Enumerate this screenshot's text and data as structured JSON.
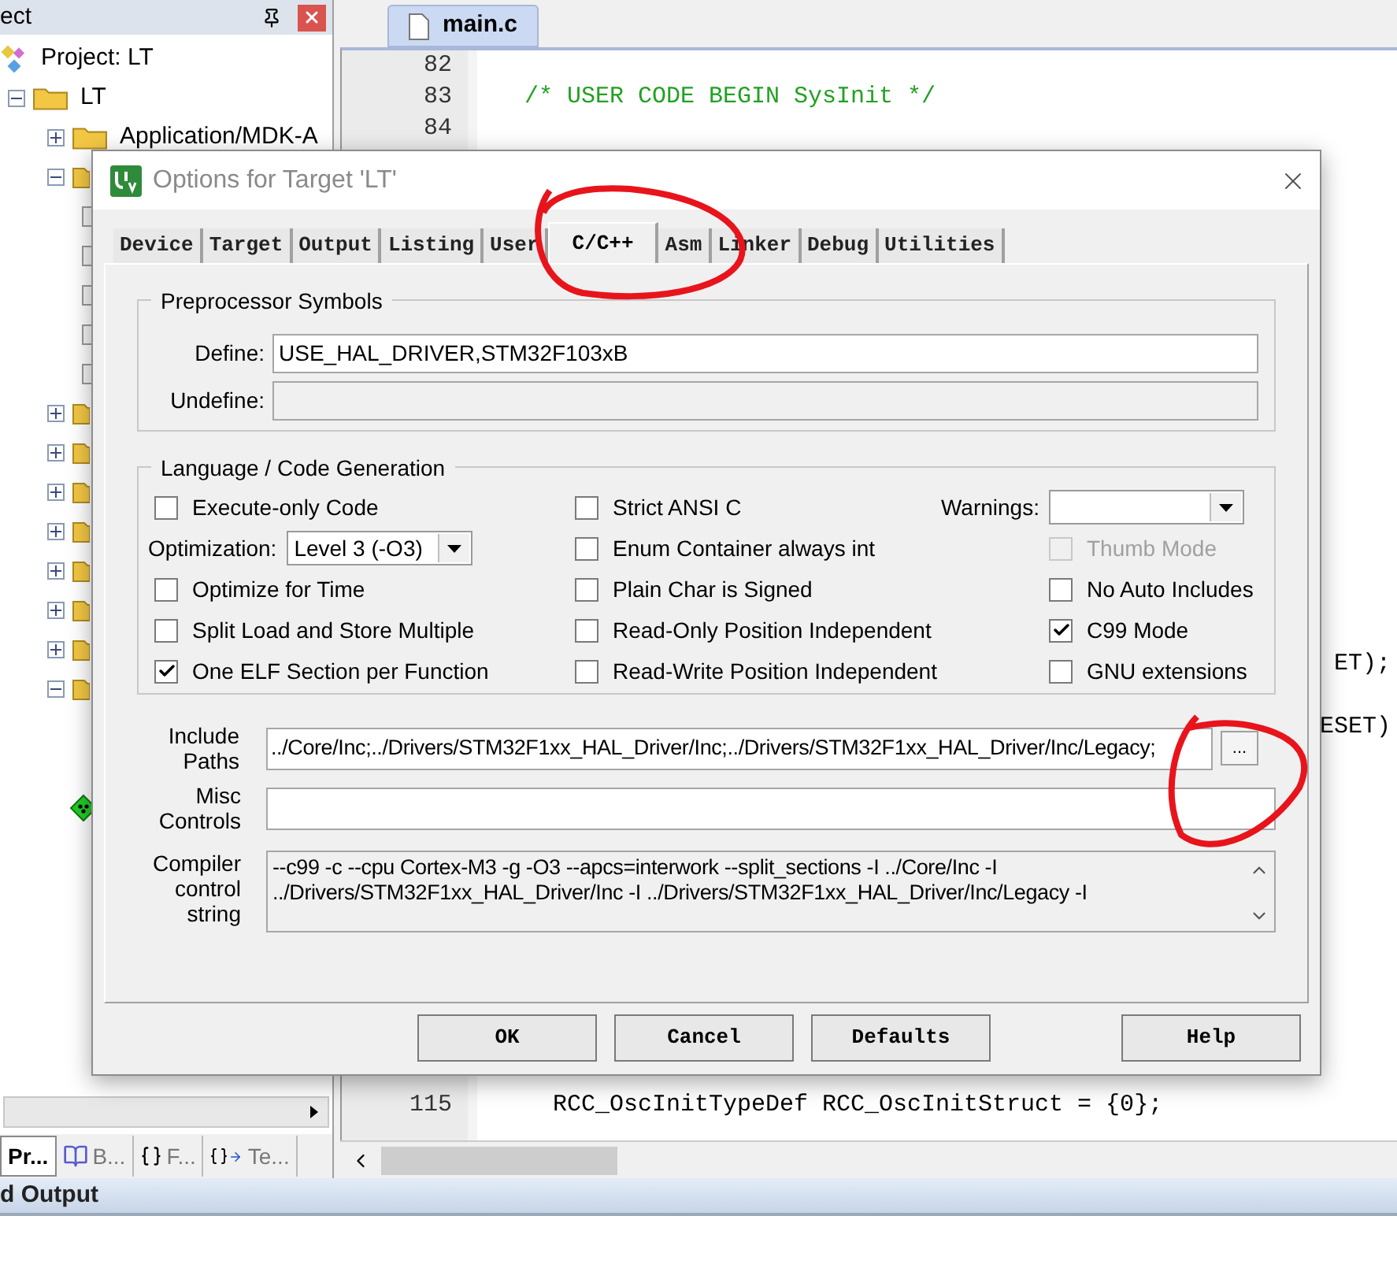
{
  "project_panel": {
    "title": "ect",
    "tree": {
      "label": "Project: LT",
      "children": [
        {
          "label": "LT",
          "expanded": true,
          "children": [
            {
              "label": "Application/MDK-A",
              "expanded": false
            },
            {
              "expanded": true,
              "children": [
                {
                  "kind": "file"
                },
                {
                  "kind": "file"
                },
                {
                  "kind": "file"
                },
                {
                  "kind": "file"
                },
                {
                  "kind": "file"
                }
              ]
            },
            {
              "expanded": false
            },
            {
              "expanded": false
            },
            {
              "expanded": false
            },
            {
              "expanded": false
            },
            {
              "expanded": false
            },
            {
              "expanded": false
            },
            {
              "expanded": false
            },
            {
              "expanded": true
            },
            {
              "kind": "component"
            }
          ]
        }
      ]
    },
    "tabs": [
      {
        "label": "Pr...",
        "selected": true
      },
      {
        "label": "B...",
        "selected": false
      },
      {
        "label": "F...",
        "selected": false
      },
      {
        "label": "Te...",
        "selected": false
      }
    ]
  },
  "editor": {
    "tab": "main.c",
    "lines": [
      {
        "kind": "code",
        "number": "82"
      },
      {
        "kind": "code",
        "number": "83",
        "code": "/* USER CODE BEGIN SysInit */",
        "comment": true
      },
      {
        "kind": "code",
        "number": "84"
      },
      {
        "kind": "hidden"
      },
      {
        "kind": "hidden"
      },
      {
        "kind": "hidden"
      },
      {
        "kind": "hidden"
      },
      {
        "kind": "hidden"
      },
      {
        "kind": "hidden"
      },
      {
        "kind": "hidden"
      },
      {
        "kind": "hidden"
      },
      {
        "kind": "hidden"
      },
      {
        "kind": "hidden"
      },
      {
        "kind": "hidden"
      },
      {
        "kind": "hidden"
      },
      {
        "kind": "hidden"
      },
      {
        "kind": "hidden"
      },
      {
        "kind": "hidden"
      },
      {
        "kind": "hidden"
      },
      {
        "kind": "tail",
        "code": "ET);"
      },
      {
        "kind": "hidden"
      },
      {
        "kind": "tail",
        "code": "ESET)"
      },
      {
        "kind": "hidden"
      },
      {
        "kind": "hidden"
      },
      {
        "kind": "hidden"
      },
      {
        "kind": "hidden"
      },
      {
        "kind": "hidden"
      },
      {
        "kind": "hidden"
      },
      {
        "kind": "hidden"
      },
      {
        "kind": "hidden"
      },
      {
        "kind": "hidden"
      },
      {
        "kind": "hidden"
      },
      {
        "kind": "hidden"
      },
      {
        "kind": "code",
        "number": "115",
        "code": "  RCC_OscInitTypeDef RCC_OscInitStruct = {0};"
      }
    ]
  },
  "output_bar": {
    "title": "d Output"
  },
  "dialog": {
    "title": "Options for Target 'LT'",
    "tabs": [
      {
        "label": "Device",
        "selected": false
      },
      {
        "label": "Target",
        "selected": false
      },
      {
        "label": "Output",
        "selected": false
      },
      {
        "label": "Listing",
        "selected": false
      },
      {
        "label": "User",
        "selected": false
      },
      {
        "label": "C/C++",
        "selected": true
      },
      {
        "label": "Asm",
        "selected": false
      },
      {
        "label": "Linker",
        "selected": false
      },
      {
        "label": "Debug",
        "selected": false
      },
      {
        "label": "Utilities",
        "selected": false
      }
    ],
    "preprocessor": {
      "title": "Preprocessor Symbols",
      "define": {
        "label": "Define:",
        "value": "USE_HAL_DRIVER,STM32F103xB"
      },
      "undefine": {
        "label": "Undefine:",
        "disabled": true
      }
    },
    "language": {
      "title": "Language / Code Generation",
      "columns": [
        [
          {
            "kind": "checkbox",
            "label": "Execute-only Code",
            "checked": false
          },
          {
            "kind": "select",
            "label": "Optimization:",
            "value": "Level 3 (-O3)"
          },
          {
            "kind": "checkbox",
            "label": "Optimize for Time",
            "checked": false
          },
          {
            "kind": "checkbox",
            "label": "Split Load and Store Multiple",
            "checked": false
          },
          {
            "kind": "checkbox",
            "label": "One ELF Section per Function",
            "checked": true
          }
        ],
        [
          {
            "kind": "checkbox",
            "label": "Strict ANSI C",
            "checked": false
          },
          {
            "kind": "checkbox",
            "label": "Enum Container always int",
            "checked": false
          },
          {
            "kind": "checkbox",
            "label": "Plain Char is Signed",
            "checked": false
          },
          {
            "kind": "checkbox",
            "label": "Read-Only Position Independent",
            "checked": false
          },
          {
            "kind": "checkbox",
            "label": "Read-Write Position Independent",
            "checked": false
          }
        ],
        [
          {
            "kind": "select",
            "label": "Warnings:"
          },
          {
            "kind": "checkbox",
            "label": "Thumb Mode",
            "checked": false,
            "disabled": true
          },
          {
            "kind": "checkbox",
            "label": "No Auto Includes",
            "checked": false
          },
          {
            "kind": "checkbox",
            "label": "C99 Mode",
            "checked": true
          },
          {
            "kind": "checkbox",
            "label": "GNU extensions",
            "checked": false
          }
        ]
      ]
    },
    "include_paths": {
      "label": "Include Paths",
      "value": "../Core/Inc;../Drivers/STM32F1xx_HAL_Driver/Inc;../Drivers/STM32F1xx_HAL_Driver/Inc/Legacy;",
      "browse": "..."
    },
    "misc_controls": {
      "label": "Misc Controls"
    },
    "compiler_string": {
      "label": "Compiler control string",
      "lines": [
        "--c99 -c --cpu Cortex-M3 -g -O3 --apcs=interwork --split_sections -I ../Core/Inc -I",
        "../Drivers/STM32F1xx_HAL_Driver/Inc -I ../Drivers/STM32F1xx_HAL_Driver/Inc/Legacy -I"
      ]
    },
    "buttons": [
      "OK",
      "Cancel",
      "Defaults",
      "Help"
    ]
  }
}
